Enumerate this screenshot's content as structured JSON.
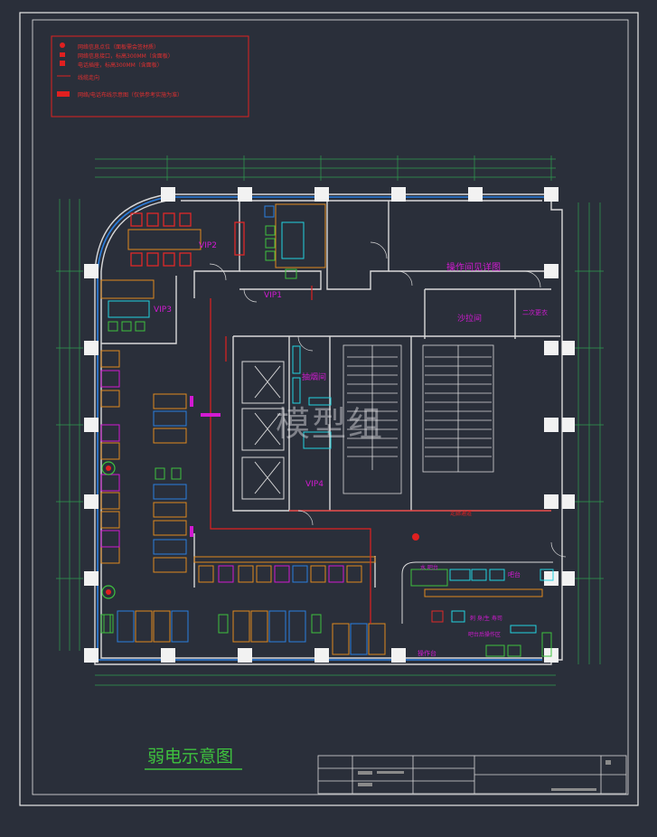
{
  "drawing_title": "弱电示意图",
  "watermark": "模型组",
  "legend": {
    "items": [
      "网络信息点位（面板需会签材质）",
      "网络信息接口，标高300MM（含面板）",
      "电话插座，标高300MM（含面板）",
      "线缆走向",
      "网络/电话布线示意图（仅供参考实施为准）"
    ]
  },
  "rooms": {
    "vip1": "VIP1",
    "vip2": "VIP2",
    "vip3": "VIP3",
    "vip4": "VIP4",
    "operation_room": "操作间见详图",
    "sand_room": "沙拉间",
    "secondary_change": "二次更衣",
    "smoking_room": "抽烟间",
    "water_bar": "水 吧台",
    "bar_counter": "吧台",
    "sushi": "刺 身/生 寿司",
    "counter_ops": "吧台后操作区",
    "operation_table": "操作台",
    "corridor_label": "走廊通道"
  },
  "colors": {
    "background": "#2a2f3a",
    "frame": "#e8e8e8",
    "wall": "#d9d9d9",
    "dimension": "#2f9e4f",
    "cable": "#e02020",
    "accent_magenta": "#d21ad2",
    "furniture_orange": "#e08a1e",
    "chair_red": "#e02828",
    "window_blue": "#2a7fe0",
    "cyan": "#22d3e0",
    "title_green": "#3ec23e"
  }
}
